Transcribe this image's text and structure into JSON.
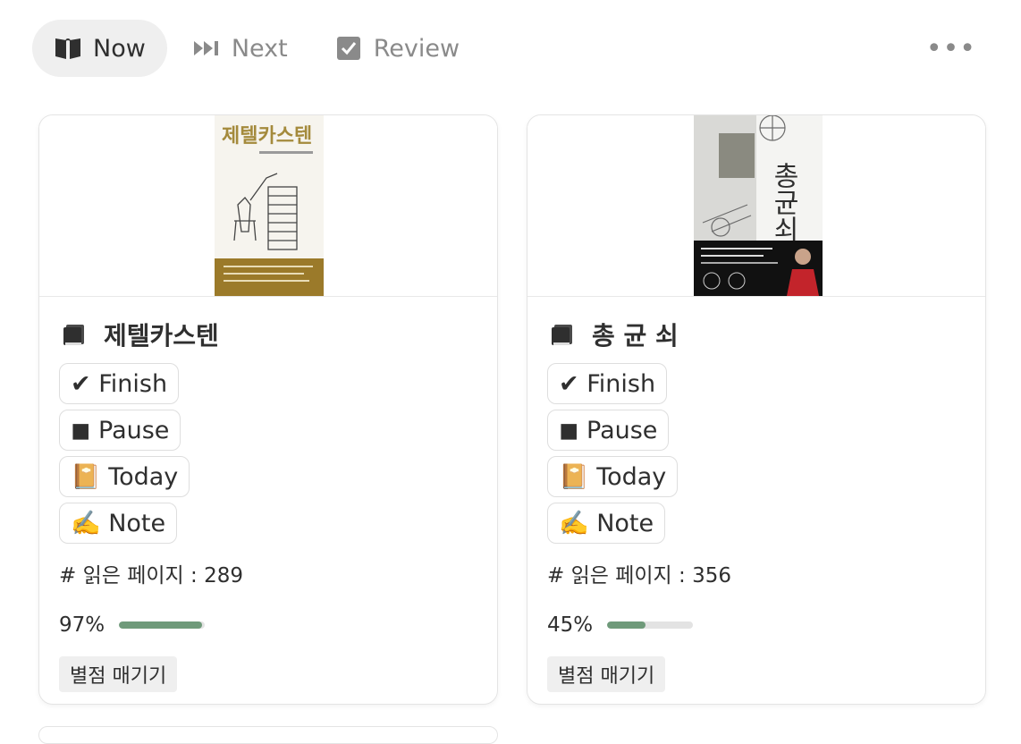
{
  "tabs": [
    {
      "label": "Now",
      "icon": "open-book-icon",
      "active": true
    },
    {
      "label": "Next",
      "icon": "next-track-icon",
      "active": false
    },
    {
      "label": "Review",
      "icon": "checkbox-icon",
      "active": false
    }
  ],
  "more_label": "•••",
  "cards": [
    {
      "cover_title": "제텔카스텐",
      "title": "제텔카스텐",
      "buttons": {
        "finish": "✔ Finish",
        "pause": "◼ Pause",
        "today": "📔 Today",
        "note": "✍️ Note"
      },
      "pages": "# 읽은 페이지 : 289",
      "progress_label": "97%",
      "progress": 0.97,
      "rating_label": "별점 매기기"
    },
    {
      "cover_title": "총균쇠",
      "title": "총 균 쇠",
      "buttons": {
        "finish": "✔ Finish",
        "pause": "◼ Pause",
        "today": "📔 Today",
        "note": "✍️ Note"
      },
      "pages": "# 읽은 페이지 : 356",
      "progress_label": "45%",
      "progress": 0.45,
      "rating_label": "별점 매기기"
    }
  ],
  "colors": {
    "progress": "#6f9a7a",
    "track": "#e3e3e3",
    "active_tab_bg": "#efefef"
  }
}
